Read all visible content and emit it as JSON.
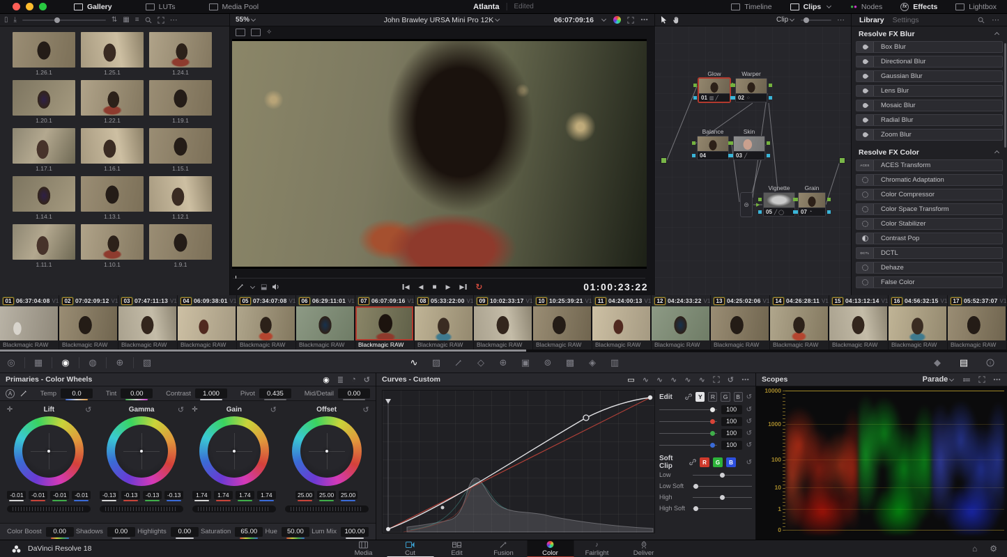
{
  "app": {
    "name": "DaVinci Resolve 18"
  },
  "titlebar": {
    "project": "Atlanta",
    "status": "Edited",
    "left_buttons": [
      {
        "label": "Gallery"
      },
      {
        "label": "LUTs"
      },
      {
        "label": "Media Pool"
      }
    ],
    "right_buttons": [
      {
        "label": "Timeline"
      },
      {
        "label": "Clips"
      },
      {
        "label": "Nodes"
      },
      {
        "label": "Effects"
      },
      {
        "label": "Lightbox"
      }
    ]
  },
  "viewer": {
    "zoom_level": "55%",
    "clip_name": "John Brawley URSA Mini Pro 12K",
    "source_tc": "06:07:09:16",
    "record_tc": "01:00:23:22"
  },
  "gallery": {
    "stills": [
      "1.26.1",
      "1.25.1",
      "1.24.1",
      "1.20.1",
      "1.22.1",
      "1.19.1",
      "1.17.1",
      "1.16.1",
      "1.15.1",
      "1.14.1",
      "1.13.1",
      "1.12.1",
      "1.11.1",
      "1.10.1",
      "1.9.1"
    ]
  },
  "nodes_panel": {
    "mode_label": "Clip",
    "nodes": [
      {
        "id": "01",
        "name": "Glow"
      },
      {
        "id": "02",
        "name": "Warper"
      },
      {
        "id": "04",
        "name": "Balance"
      },
      {
        "id": "03",
        "name": "Skin"
      },
      {
        "id": "05",
        "name": "Vignette"
      },
      {
        "id": "07",
        "name": "Grain"
      }
    ]
  },
  "library": {
    "tab_library": "Library",
    "tab_settings": "Settings",
    "sections": [
      {
        "title": "Resolve FX Blur",
        "items": [
          "Box Blur",
          "Directional Blur",
          "Gaussian Blur",
          "Lens Blur",
          "Mosaic Blur",
          "Radial Blur",
          "Zoom Blur"
        ]
      },
      {
        "title": "Resolve FX Color",
        "items": [
          "ACES Transform",
          "Chromatic Adaptation",
          "Color Compressor",
          "Color Space Transform",
          "Color Stabilizer",
          "Contrast Pop",
          "DCTL",
          "Dehaze",
          "False Color"
        ]
      }
    ]
  },
  "timeline": {
    "clips": [
      {
        "num": "01",
        "tc": "06:37:04:08",
        "track": "V1",
        "codec": "Blackmagic RAW"
      },
      {
        "num": "02",
        "tc": "07:02:09:12",
        "track": "V1",
        "codec": "Blackmagic RAW"
      },
      {
        "num": "03",
        "tc": "07:47:11:13",
        "track": "V1",
        "codec": "Blackmagic RAW"
      },
      {
        "num": "04",
        "tc": "06:09:38:01",
        "track": "V1",
        "codec": "Blackmagic RAW"
      },
      {
        "num": "05",
        "tc": "07:34:07:08",
        "track": "V1",
        "codec": "Blackmagic RAW"
      },
      {
        "num": "06",
        "tc": "06:29:11:01",
        "track": "V1",
        "codec": "Blackmagic RAW"
      },
      {
        "num": "07",
        "tc": "06:07:09:16",
        "track": "V1",
        "codec": "Blackmagic RAW"
      },
      {
        "num": "08",
        "tc": "05:33:22:00",
        "track": "V1",
        "codec": "Blackmagic RAW"
      },
      {
        "num": "09",
        "tc": "10:02:33:17",
        "track": "V1",
        "codec": "Blackmagic RAW"
      },
      {
        "num": "10",
        "tc": "10:25:39:21",
        "track": "V1",
        "codec": "Blackmagic RAW"
      },
      {
        "num": "11",
        "tc": "04:24:00:13",
        "track": "V1",
        "codec": "Blackmagic RAW"
      },
      {
        "num": "12",
        "tc": "04:24:33:22",
        "track": "V1",
        "codec": "Blackmagic RAW"
      },
      {
        "num": "13",
        "tc": "04:25:02:06",
        "track": "V1",
        "codec": "Blackmagic RAW"
      },
      {
        "num": "14",
        "tc": "04:26:28:11",
        "track": "V1",
        "codec": "Blackmagic RAW"
      },
      {
        "num": "15",
        "tc": "04:13:12:14",
        "track": "V1",
        "codec": "Blackmagic RAW"
      },
      {
        "num": "16",
        "tc": "04:56:32:15",
        "track": "V1",
        "codec": "Blackmagic RAW"
      },
      {
        "num": "17",
        "tc": "05:52:37:07",
        "track": "V1",
        "codec": "Blackmagic RAW"
      }
    ]
  },
  "primaries": {
    "title": "Primaries - Color Wheels",
    "params": [
      {
        "label": "Temp",
        "value": "0.0"
      },
      {
        "label": "Tint",
        "value": "0.00"
      },
      {
        "label": "Contrast",
        "value": "1.000"
      },
      {
        "label": "Pivot",
        "value": "0.435"
      },
      {
        "label": "Mid/Detail",
        "value": "0.00"
      }
    ],
    "wheels": [
      {
        "name": "Lift",
        "values": [
          "-0.01",
          "-0.01",
          "-0.01",
          "-0.01"
        ]
      },
      {
        "name": "Gamma",
        "values": [
          "-0.13",
          "-0.13",
          "-0.13",
          "-0.13"
        ]
      },
      {
        "name": "Gain",
        "values": [
          "1.74",
          "1.74",
          "1.74",
          "1.74"
        ]
      },
      {
        "name": "Offset",
        "values": [
          "25.00",
          "25.00",
          "25.00"
        ]
      }
    ],
    "footer": [
      {
        "label": "Color Boost",
        "value": "0.00"
      },
      {
        "label": "Shadows",
        "value": "0.00"
      },
      {
        "label": "Highlights",
        "value": "0.00"
      },
      {
        "label": "Saturation",
        "value": "65.00"
      },
      {
        "label": "Hue",
        "value": "50.00"
      },
      {
        "label": "Lum Mix",
        "value": "100.00"
      }
    ]
  },
  "curves": {
    "title": "Curves - Custom",
    "edit_label": "Edit",
    "channels": [
      "Y",
      "R",
      "G",
      "B"
    ],
    "channel_values": [
      "100",
      "100",
      "100",
      "100"
    ],
    "soft_clip_label": "Soft Clip",
    "soft_clip_channels": [
      "R",
      "G",
      "B"
    ],
    "sliders": [
      "Low",
      "Low Soft",
      "High",
      "High Soft"
    ]
  },
  "scopes": {
    "title": "Scopes",
    "mode": "Parade",
    "scale": [
      "10000",
      "1000",
      "100",
      "10",
      "1",
      "0"
    ]
  },
  "pages": {
    "items": [
      "Media",
      "Cut",
      "Edit",
      "Fusion",
      "Color",
      "Fairlight",
      "Deliver"
    ]
  }
}
